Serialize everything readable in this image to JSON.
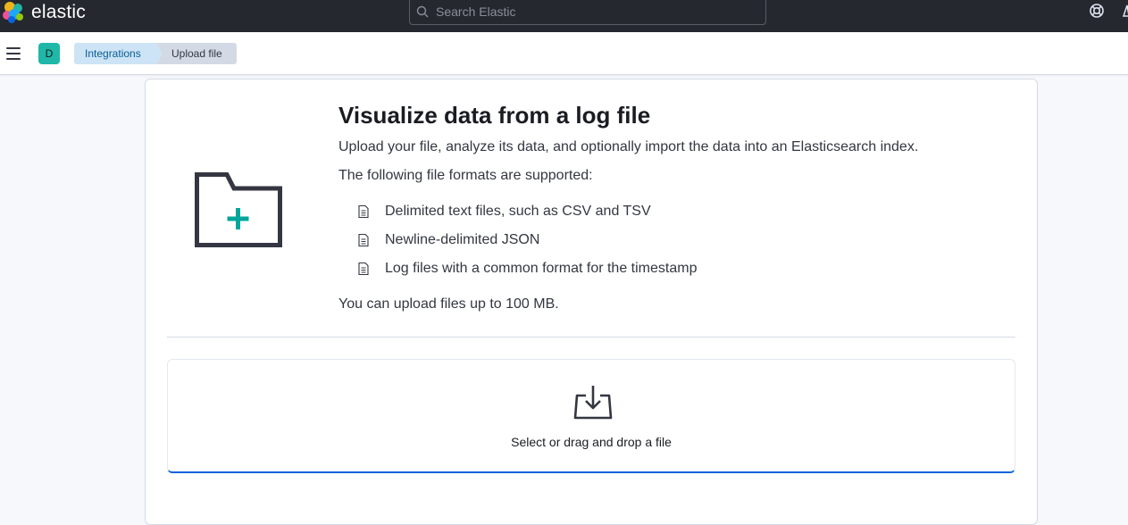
{
  "header": {
    "logo_text": "elastic",
    "search_placeholder": "Search Elastic",
    "help_icon": "help-icon"
  },
  "breadcrumbs": {
    "space_initial": "D",
    "items": [
      {
        "label": "Integrations"
      },
      {
        "label": "Upload file"
      }
    ]
  },
  "main": {
    "title": "Visualize data from a log file",
    "subtitle": "Upload your file, analyze its data, and optionally import the data into an Elasticsearch index.",
    "formats_intro": "The following file formats are supported:",
    "formats": [
      {
        "label": "Delimited text files, such as CSV and TSV",
        "icon": "document-icon"
      },
      {
        "label": "Newline-delimited JSON",
        "icon": "document-icon"
      },
      {
        "label": "Log files with a common format for the timestamp",
        "icon": "document-icon"
      }
    ],
    "size_limit": "You can upload files up to 100 MB.",
    "dropzone_label": "Select or drag and drop a file"
  },
  "colors": {
    "header_bg": "#25282f",
    "accent": "#0b64dd",
    "teal": "#00a69b",
    "avatar": "#1fb8a8"
  }
}
